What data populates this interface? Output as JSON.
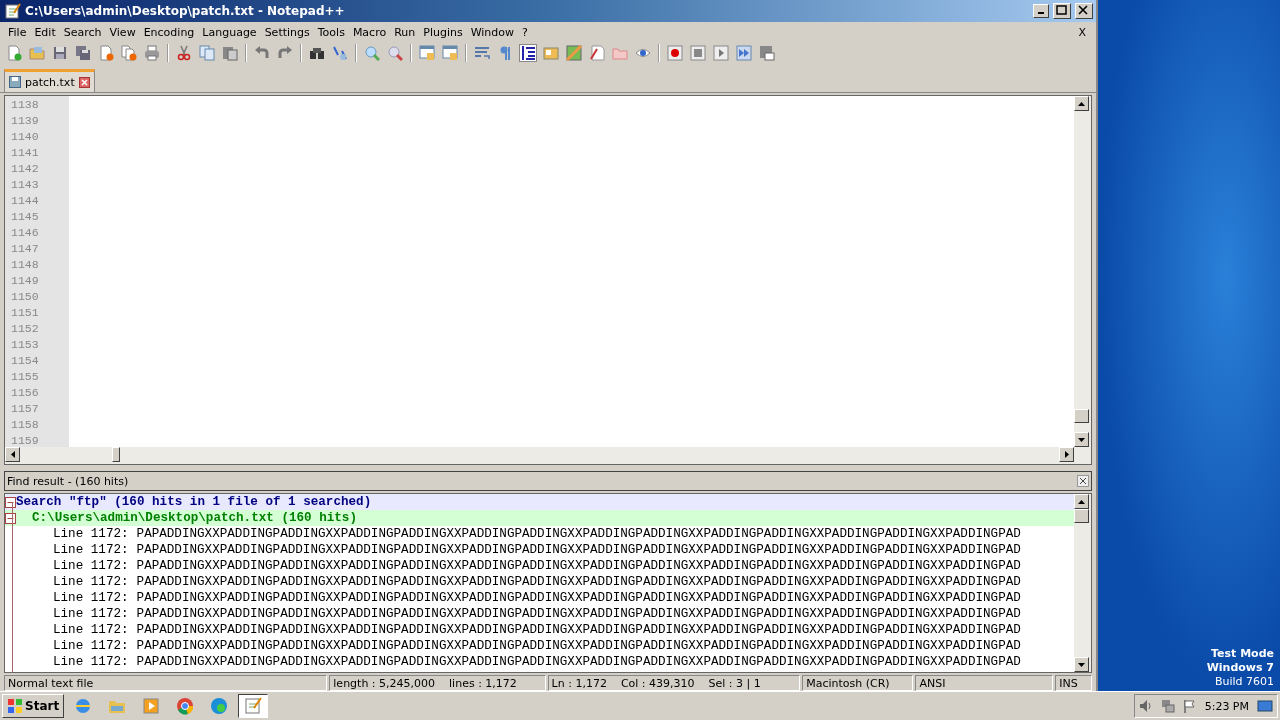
{
  "window": {
    "title": "C:\\Users\\admin\\Desktop\\patch.txt - Notepad++"
  },
  "menu": {
    "items": [
      "File",
      "Edit",
      "Search",
      "View",
      "Encoding",
      "Language",
      "Settings",
      "Tools",
      "Macro",
      "Run",
      "Plugins",
      "Window",
      "?"
    ],
    "close": "X"
  },
  "toolbar": {
    "indent_guide_on": true
  },
  "tabs": [
    {
      "label": "patch.txt",
      "selected": true
    }
  ],
  "editor": {
    "line_numbers": [
      "1138",
      "1139",
      "1140",
      "1141",
      "1142",
      "1143",
      "1144",
      "1145",
      "1146",
      "1147",
      "1148",
      "1149",
      "1150",
      "1151",
      "1152",
      "1153",
      "1154",
      "1155",
      "1156",
      "1157",
      "1158",
      "1159"
    ]
  },
  "find_result": {
    "title": "Find result - (160 hits)",
    "search": {
      "text": "Search \"ftp\" (160 hits in 1 file of 1 searched)",
      "expanded": true
    },
    "file": {
      "text": "C:\\Users\\admin\\Desktop\\patch.txt (160 hits)",
      "expanded": true
    },
    "hits": [
      {
        "line": "Line 1172:",
        "text": "PAPADDINGXXPADDINGPADDINGXXPADDINGPADDINGXXPADDINGPADDINGXXPADDINGPADDINGXXPADDINGPADDINGXXPADDINGPADDINGXXPADDINGPAD"
      },
      {
        "line": "Line 1172:",
        "text": "PAPADDINGXXPADDINGPADDINGXXPADDINGPADDINGXXPADDINGPADDINGXXPADDINGPADDINGXXPADDINGPADDINGXXPADDINGPADDINGXXPADDINGPAD"
      },
      {
        "line": "Line 1172:",
        "text": "PAPADDINGXXPADDINGPADDINGXXPADDINGPADDINGXXPADDINGPADDINGXXPADDINGPADDINGXXPADDINGPADDINGXXPADDINGPADDINGXXPADDINGPAD"
      },
      {
        "line": "Line 1172:",
        "text": "PAPADDINGXXPADDINGPADDINGXXPADDINGPADDINGXXPADDINGPADDINGXXPADDINGPADDINGXXPADDINGPADDINGXXPADDINGPADDINGXXPADDINGPAD"
      },
      {
        "line": "Line 1172:",
        "text": "PAPADDINGXXPADDINGPADDINGXXPADDINGPADDINGXXPADDINGPADDINGXXPADDINGPADDINGXXPADDINGPADDINGXXPADDINGPADDINGXXPADDINGPAD"
      },
      {
        "line": "Line 1172:",
        "text": "PAPADDINGXXPADDINGPADDINGXXPADDINGPADDINGXXPADDINGPADDINGXXPADDINGPADDINGXXPADDINGPADDINGXXPADDINGPADDINGXXPADDINGPAD"
      },
      {
        "line": "Line 1172:",
        "text": "PAPADDINGXXPADDINGPADDINGXXPADDINGPADDINGXXPADDINGPADDINGXXPADDINGPADDINGXXPADDINGPADDINGXXPADDINGPADDINGXXPADDINGPAD"
      },
      {
        "line": "Line 1172:",
        "text": "PAPADDINGXXPADDINGPADDINGXXPADDINGPADDINGXXPADDINGPADDINGXXPADDINGPADDINGXXPADDINGPADDINGXXPADDINGPADDINGXXPADDINGPAD"
      },
      {
        "line": "Line 1172:",
        "text": "PAPADDINGXXPADDINGPADDINGXXPADDINGPADDINGXXPADDINGPADDINGXXPADDINGPADDINGXXPADDINGPADDINGXXPADDINGPADDINGXXPADDINGPAD"
      }
    ]
  },
  "status_bar": {
    "sections": [
      [
        "Normal text file"
      ],
      [
        "length : 5,245,000",
        "lines : 1,172"
      ],
      [
        "Ln : 1,172",
        "Col : 439,310",
        "Sel : 3 | 1"
      ],
      [
        "Macintosh (CR)"
      ],
      [
        "ANSI"
      ],
      [
        "INS"
      ]
    ]
  },
  "desktop": {
    "lines": [
      "Test Mode",
      "Windows 7",
      "Build 7601"
    ]
  },
  "taskbar": {
    "start": "Start",
    "apps": [
      {
        "selected": false
      },
      {
        "selected": false
      },
      {
        "selected": false
      },
      {
        "selected": false
      },
      {
        "selected": false
      },
      {
        "selected": true
      }
    ],
    "clock": "5:23 PM"
  }
}
